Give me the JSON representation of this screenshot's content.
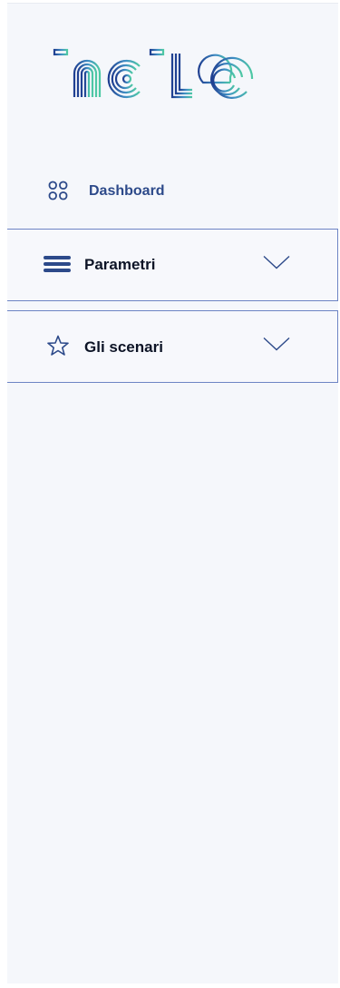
{
  "brand": {
    "logo_text": "incite",
    "icon": "incite-logo-icon"
  },
  "nav": {
    "dashboard": {
      "label": "Dashboard",
      "icon": "grid-icon"
    },
    "parametri": {
      "label": "Parametri",
      "icon": "menu-lines-icon",
      "chevron": "chevron-down-icon"
    },
    "scenari": {
      "label": "Gli scenari",
      "icon": "star-icon",
      "chevron": "chevron-down-icon"
    }
  },
  "colors": {
    "sidebar_bg": "#f5f7fb",
    "accent": "#2d4a8a",
    "border": "#6d84c4",
    "text": "#0d1426",
    "logo_gradient_start": "#1f3f91",
    "logo_gradient_end": "#4ec9a4"
  }
}
